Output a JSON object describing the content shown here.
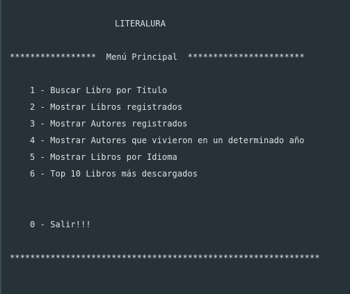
{
  "console": {
    "title": "LITERALURA",
    "menu_header": "*****************  Menú Principal  ***********************",
    "options": [
      "1 - Buscar Libro por Título",
      "2 - Mostrar Libros registrados",
      "3 - Mostrar Autores registrados",
      "4 - Mostrar Autores que vivieron en un determinado año",
      "5 - Mostrar Libros por Idioma",
      "6 - Top 10 Libros más descargados"
    ],
    "exit_option": "0 - Salir!!!",
    "footer_rule": "*************************************************************"
  },
  "colors": {
    "background": "#263238",
    "text": "#dde2e4",
    "gutter_edge": "#3f4c53"
  }
}
